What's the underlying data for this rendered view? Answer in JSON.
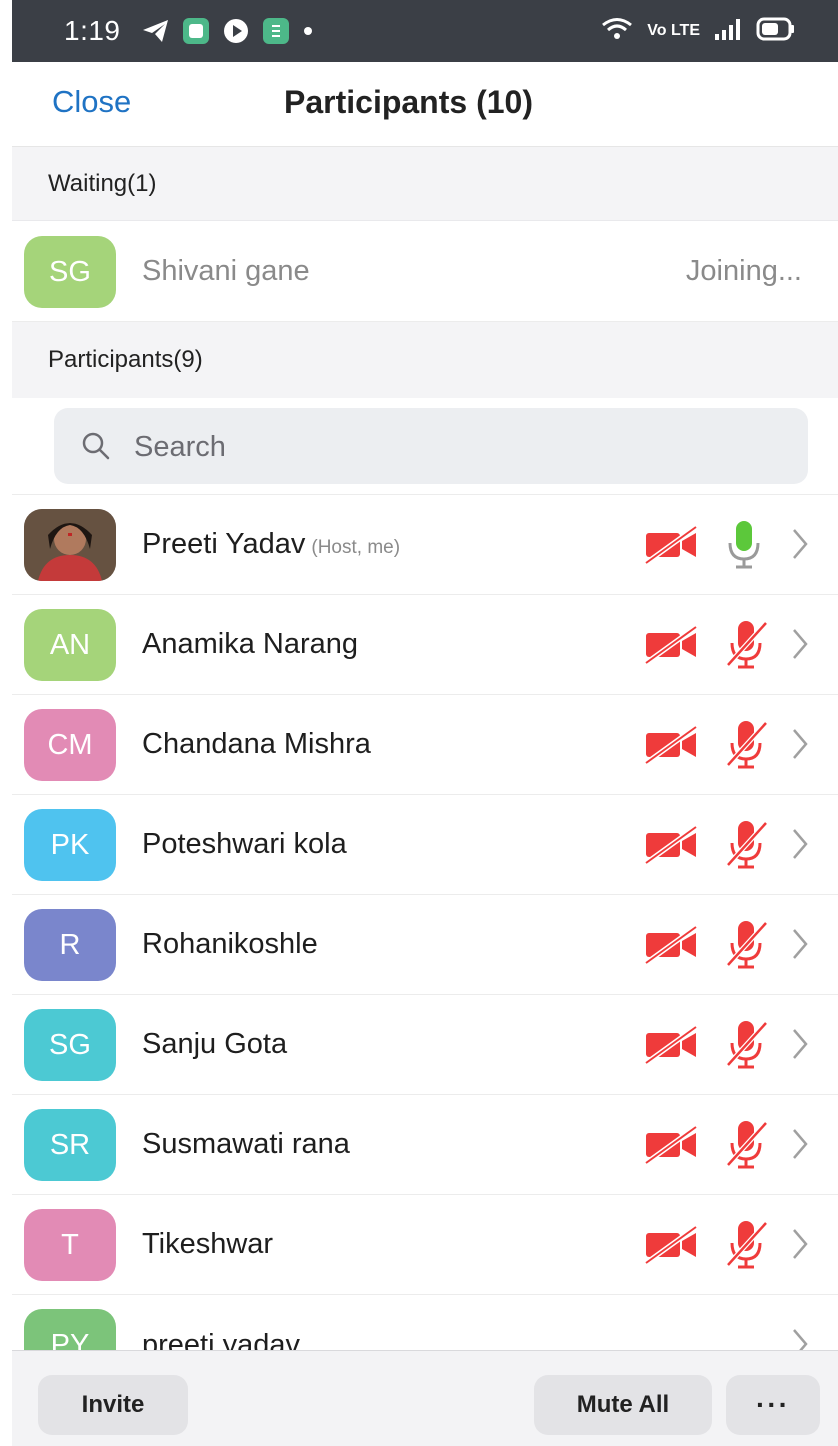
{
  "status_bar": {
    "time": "1:19",
    "network": "Vo LTE"
  },
  "header": {
    "close_label": "Close",
    "title": "Participants (10)"
  },
  "waiting": {
    "label": "Waiting(1)",
    "items": [
      {
        "initials": "SG",
        "name": "Shivani gane",
        "status": "Joining...",
        "color": "#a5d47a"
      }
    ]
  },
  "participants": {
    "label": "Participants(9)",
    "search_placeholder": "Search",
    "items": [
      {
        "initials": "",
        "name": "Preeti Yadav",
        "sub": "(Host, me)",
        "color": "#7a4a3a",
        "mic": "on",
        "video": "off"
      },
      {
        "initials": "AN",
        "name": "Anamika Narang",
        "color": "#a5d47a",
        "mic": "muted",
        "video": "off"
      },
      {
        "initials": "CM",
        "name": "Chandana Mishra",
        "color": "#e28bb5",
        "mic": "muted",
        "video": "off"
      },
      {
        "initials": "PK",
        "name": "Poteshwari kola",
        "color": "#4fc3ef",
        "mic": "muted",
        "video": "off"
      },
      {
        "initials": "R",
        "name": "Rohanikoshle",
        "color": "#7a86cc",
        "mic": "muted",
        "video": "off"
      },
      {
        "initials": "SG",
        "name": "Sanju Gota",
        "color": "#4cc9d3",
        "mic": "muted",
        "video": "off"
      },
      {
        "initials": "SR",
        "name": "Susmawati rana",
        "color": "#4cc9d3",
        "mic": "muted",
        "video": "off"
      },
      {
        "initials": "T",
        "name": "Tikeshwar",
        "color": "#e28bb5",
        "mic": "muted",
        "video": "off"
      },
      {
        "initials": "PY",
        "name": "preeti yadav",
        "color": "#7cc47a"
      }
    ]
  },
  "footer": {
    "invite_label": "Invite",
    "mute_all_label": "Mute All",
    "more_label": "···"
  },
  "colors": {
    "accent": "#1f73c4",
    "muted_red": "#ef3b3b",
    "mic_on_green": "#5cc83b"
  }
}
